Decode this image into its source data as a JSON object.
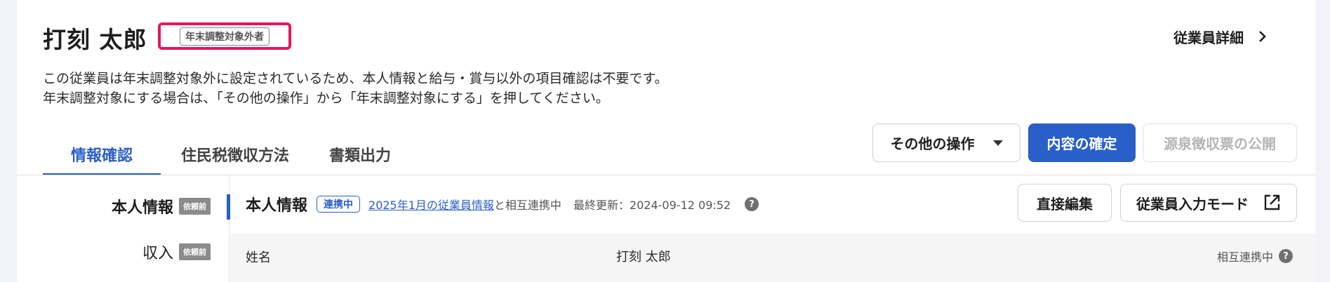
{
  "header": {
    "employee_name": "打刻 太郎",
    "badge": "年末調整対象外者",
    "detail_link": "従業員詳細"
  },
  "notice": {
    "line1": "この従業員は年末調整対象外に設定されているため、本人情報と給与・賞与以外の項目確認は不要です。",
    "line2": "年末調整対象にする場合は、「その他の操作」から「年末調整対象にする」を押してください。"
  },
  "tabs": [
    {
      "label": "情報確認",
      "active": true
    },
    {
      "label": "住民税徴収方法",
      "active": false
    },
    {
      "label": "書類出力",
      "active": false
    }
  ],
  "actions": {
    "other_ops": "その他の操作",
    "confirm": "内容の確定",
    "publish": "源泉徴収票の公開"
  },
  "sidebar": {
    "items": [
      {
        "label": "本人情報",
        "badge": "依頼前",
        "active": true
      },
      {
        "label": "収入",
        "badge": "依頼前",
        "active": false
      }
    ]
  },
  "section": {
    "title": "本人情報",
    "sync_tag": "連携中",
    "sync_link": "2025年1月の従業員情報",
    "sync_after": "と相互連携中",
    "updated": "最終更新：2024-09-12 09:52",
    "help": "?",
    "edit_button": "直接編集",
    "input_mode_button": "従業員入力モード"
  },
  "rows": [
    {
      "label": "姓名",
      "value": "打刻 太郎",
      "status": "相互連携中"
    }
  ],
  "colors": {
    "accent": "#2b5fc8",
    "badge_highlight": "#e8145c",
    "page_bg": "#f1f3f9"
  }
}
